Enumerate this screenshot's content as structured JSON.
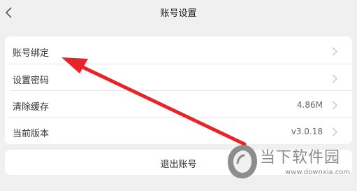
{
  "header": {
    "title": "账号设置",
    "back_icon": "chevron-left-icon"
  },
  "settings": {
    "items": [
      {
        "label": "账号绑定",
        "value": ""
      },
      {
        "label": "设置密码",
        "value": ""
      },
      {
        "label": "清除缓存",
        "value": "4.86M"
      },
      {
        "label": "当前版本",
        "value": "v3.0.18"
      }
    ]
  },
  "logout_label": "退出账号",
  "annotation": {
    "arrow_color": "#e8232a"
  },
  "watermark": {
    "name": "当下软件园",
    "url": "www.downxia.com",
    "color": "#8a8a8a"
  },
  "colors": {
    "background": "#f0f0f0",
    "card": "#ffffff",
    "chevron": "#c4c4c4"
  }
}
